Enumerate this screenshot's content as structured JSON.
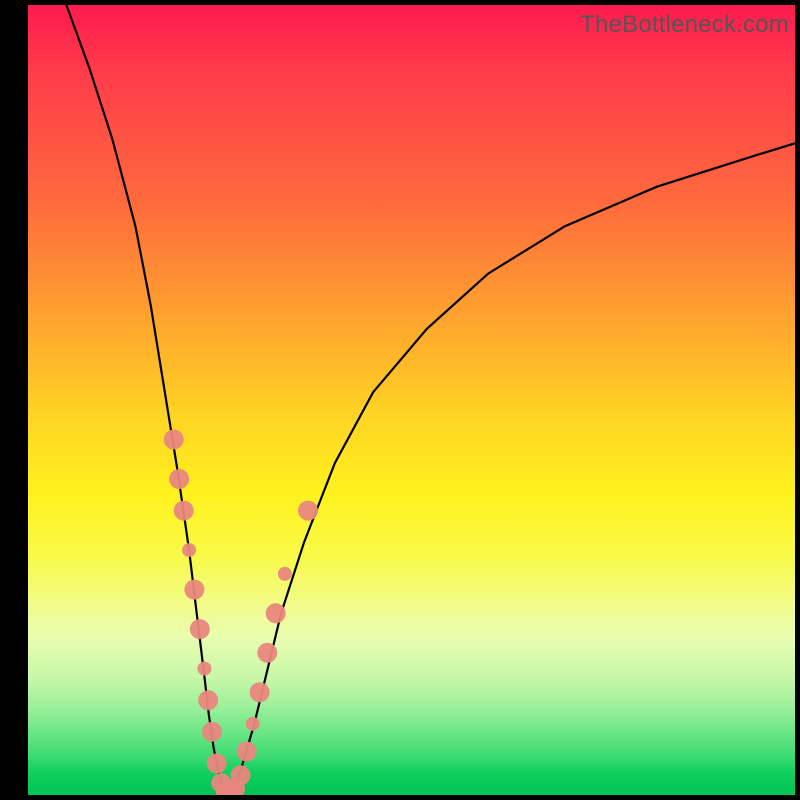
{
  "watermark": "TheBottleneck.com",
  "colors": {
    "page_bg": "#000000",
    "marker": "#e9877e",
    "curve": "#000000"
  },
  "chart_data": {
    "type": "line",
    "title": "",
    "xlabel": "",
    "ylabel": "",
    "xlim": [
      0,
      100
    ],
    "ylim": [
      0,
      100
    ],
    "series": [
      {
        "name": "left-branch",
        "x": [
          5,
          8,
          11,
          14,
          16,
          18,
          19.5,
          21,
          22,
          23,
          23.6,
          24.2,
          24.8,
          25.3,
          25.8,
          26.3
        ],
        "y": [
          100,
          92,
          83,
          72,
          62,
          50,
          41,
          31,
          23,
          15,
          10,
          6,
          3,
          1.2,
          0.3,
          0
        ]
      },
      {
        "name": "right-branch",
        "x": [
          26.3,
          27,
          28,
          29.5,
          31,
          33,
          36,
          40,
          45,
          52,
          60,
          70,
          82,
          95,
          100
        ],
        "y": [
          0,
          1,
          4,
          9,
          15,
          23,
          32,
          42,
          51,
          59,
          66,
          72,
          77,
          81,
          82.5
        ]
      }
    ],
    "markers": [
      {
        "branch": "left",
        "x": 19.0,
        "y": 45,
        "r": 10
      },
      {
        "branch": "left",
        "x": 19.7,
        "y": 40,
        "r": 10
      },
      {
        "branch": "left",
        "x": 20.3,
        "y": 36,
        "r": 10
      },
      {
        "branch": "left",
        "x": 21.0,
        "y": 31,
        "r": 7
      },
      {
        "branch": "left",
        "x": 21.7,
        "y": 26,
        "r": 10
      },
      {
        "branch": "left",
        "x": 22.4,
        "y": 21,
        "r": 10
      },
      {
        "branch": "left",
        "x": 23.0,
        "y": 16,
        "r": 7
      },
      {
        "branch": "left",
        "x": 23.5,
        "y": 12,
        "r": 10
      },
      {
        "branch": "left",
        "x": 24.0,
        "y": 8,
        "r": 10
      },
      {
        "branch": "left",
        "x": 24.6,
        "y": 4,
        "r": 10
      },
      {
        "branch": "left",
        "x": 25.2,
        "y": 1.5,
        "r": 10
      },
      {
        "branch": "valley",
        "x": 25.8,
        "y": 0.3,
        "r": 10
      },
      {
        "branch": "valley",
        "x": 26.4,
        "y": 0.2,
        "r": 10
      },
      {
        "branch": "valley",
        "x": 27.0,
        "y": 0.8,
        "r": 10
      },
      {
        "branch": "right",
        "x": 27.7,
        "y": 2.5,
        "r": 10
      },
      {
        "branch": "right",
        "x": 28.5,
        "y": 5.5,
        "r": 10
      },
      {
        "branch": "right",
        "x": 29.3,
        "y": 9,
        "r": 7
      },
      {
        "branch": "right",
        "x": 30.2,
        "y": 13,
        "r": 10
      },
      {
        "branch": "right",
        "x": 31.2,
        "y": 18,
        "r": 10
      },
      {
        "branch": "right",
        "x": 32.3,
        "y": 23,
        "r": 10
      },
      {
        "branch": "right",
        "x": 33.5,
        "y": 28,
        "r": 7
      },
      {
        "branch": "right",
        "x": 36.5,
        "y": 36,
        "r": 10
      }
    ]
  }
}
